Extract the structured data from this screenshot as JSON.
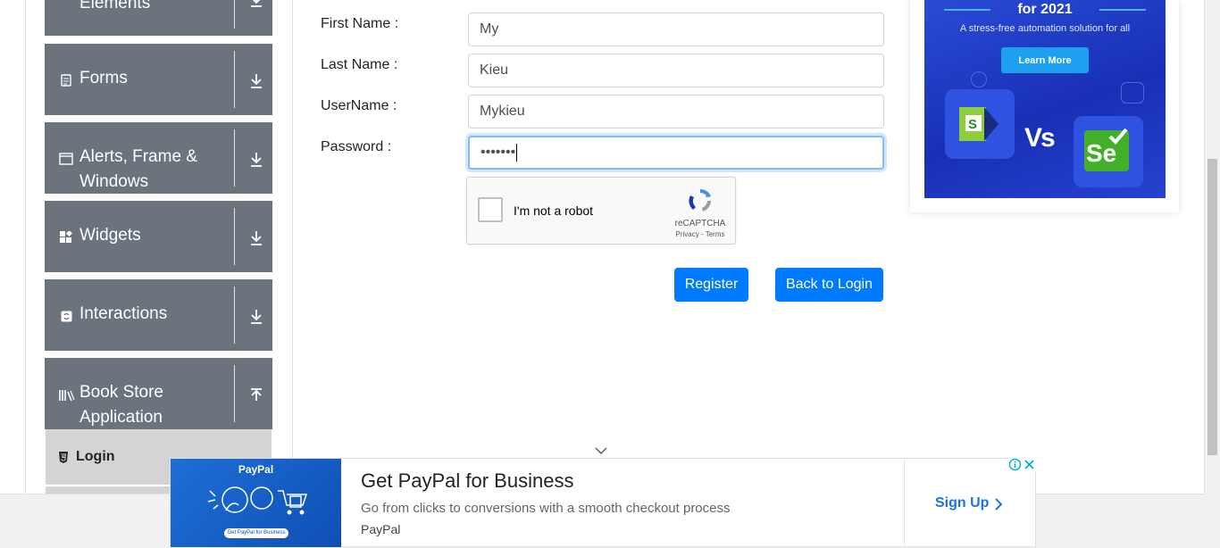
{
  "sidebar": {
    "groups": [
      {
        "label": "Elements",
        "icon": "hamburger-icon",
        "arrow": "download-arrow-icon"
      },
      {
        "label": "Forms",
        "icon": "document-icon",
        "arrow": "download-arrow-icon"
      },
      {
        "label": "Alerts, Frame & Windows",
        "icon": "window-icon",
        "arrow": "download-arrow-icon"
      },
      {
        "label": "Widgets",
        "icon": "widgets-icon",
        "arrow": "download-arrow-icon"
      },
      {
        "label": "Interactions",
        "icon": "refresh-icon",
        "arrow": "download-arrow-icon"
      },
      {
        "label": "Book Store Application",
        "icon": "library-icon",
        "arrow": "upload-arrow-icon"
      }
    ],
    "active_item": {
      "label": "Login",
      "icon": "html5-icon"
    }
  },
  "form": {
    "first_name_label": "First Name :",
    "first_name_value": "My",
    "last_name_label": "Last Name :",
    "last_name_value": "Kieu",
    "username_label": "UserName :",
    "username_value": "Mykieu",
    "password_label": "Password :",
    "password_value": "•••••••",
    "register_label": "Register",
    "back_label": "Back to Login"
  },
  "captcha": {
    "text": "I'm not a robot",
    "brand": "reCAPTCHA",
    "terms": "Privacy - Terms"
  },
  "ad_top": {
    "title": "for 2021",
    "subtitle": "A stress-free automation solution for all",
    "cta": "Learn More",
    "vs_text": "Vs",
    "se_text": "Se"
  },
  "ad_bottom": {
    "logo": "PayPal",
    "image_button": "Get PayPal for Business",
    "headline": "Get PayPal for Business",
    "description": "Go from clicks to conversions with a smooth checkout process",
    "brand": "PayPal",
    "cta": "Sign Up"
  },
  "colors": {
    "sidebar_group_bg": "#6b737c",
    "active_item_bg": "#d4d4d4",
    "primary_button": "#007bff",
    "input_focus": "#80bdff"
  }
}
